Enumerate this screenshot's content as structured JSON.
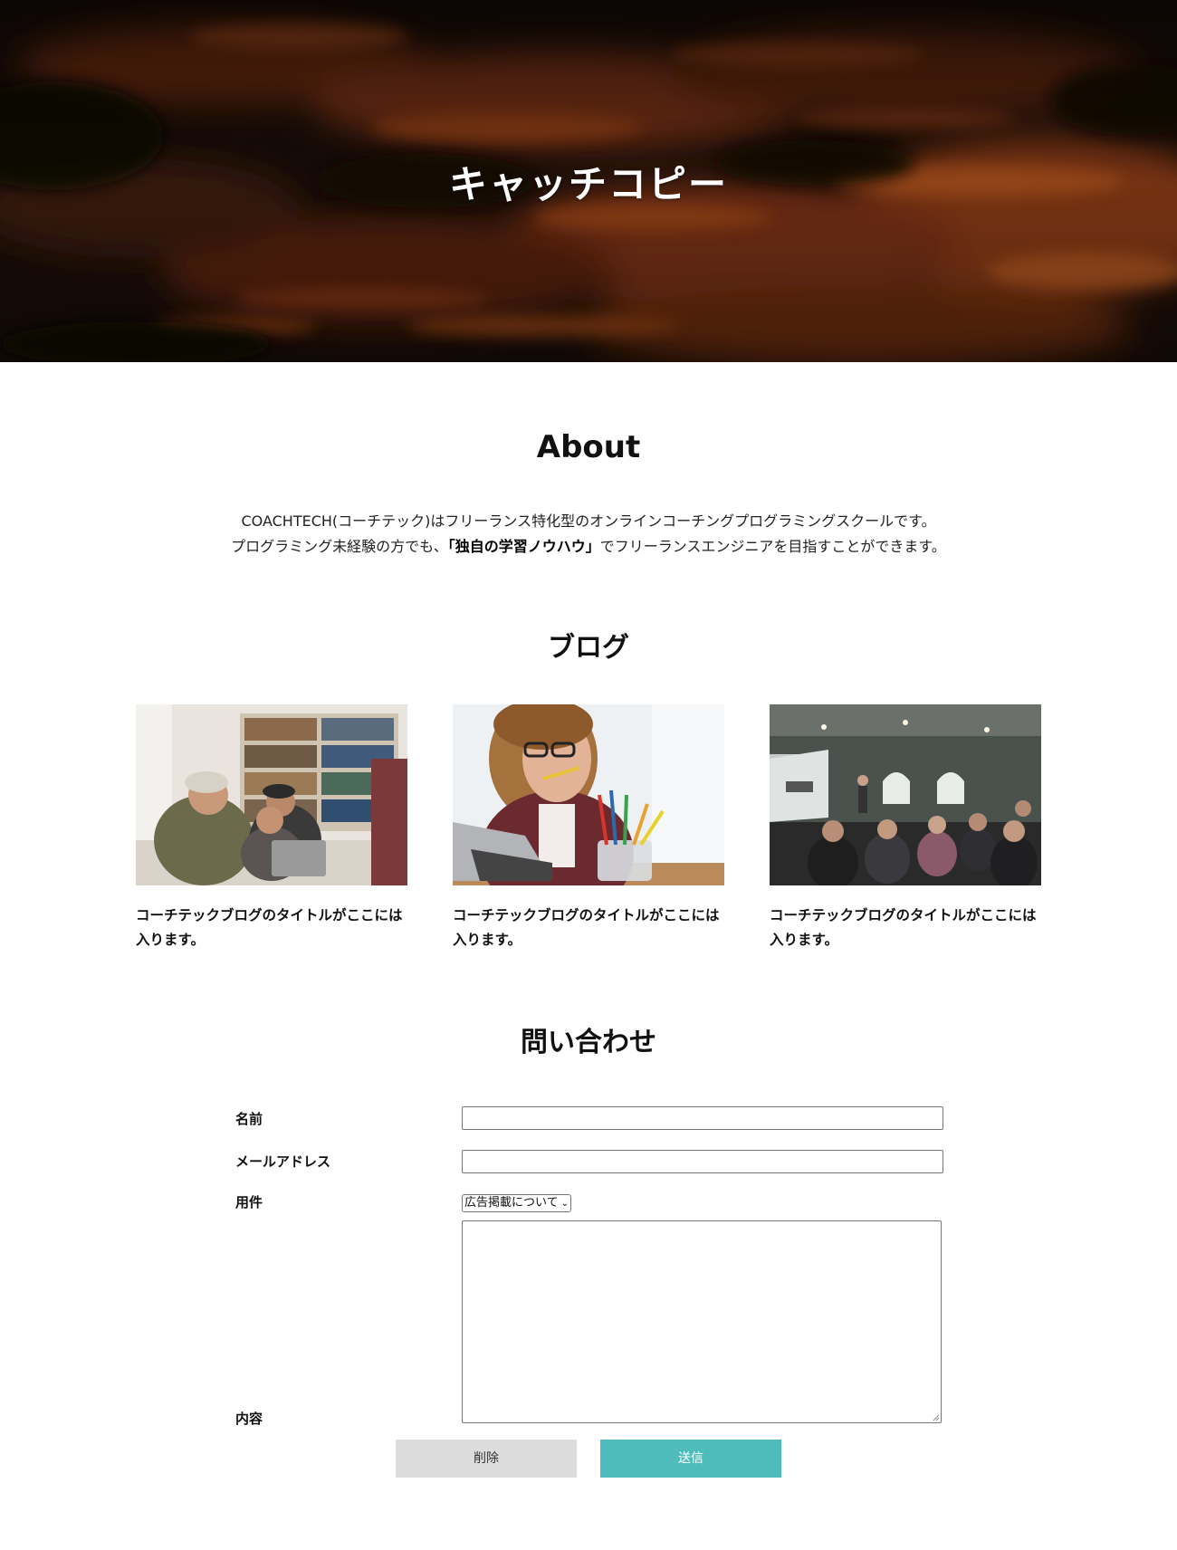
{
  "hero": {
    "catch_copy": "キャッチコピー"
  },
  "about": {
    "title": "About",
    "line1": "COACHTECH(コーチテック)はフリーランス特化型のオンラインコーチングプログラミングスクールです。",
    "line2_prefix": "プログラミング未経験の方でも、",
    "line2_bold": "「独自の学習ノウハウ」",
    "line2_suffix": "でフリーランスエンジニアを目指すことができます。"
  },
  "blog": {
    "title": "ブログ",
    "posts": [
      {
        "title": "コーチテックブログのタイトルがここには入ります。",
        "image": "people-at-laptop-photo"
      },
      {
        "title": "コーチテックブログのタイトルがここには入ります。",
        "image": "woman-with-pencils-photo"
      },
      {
        "title": "コーチテックブログのタイトルがここには入ります。",
        "image": "seminar-room-photo"
      }
    ]
  },
  "contact": {
    "title": "問い合わせ",
    "name_label": "名前",
    "name_value": "",
    "email_label": "メールアドレス",
    "email_value": "",
    "subject_label": "用件",
    "subject_selected": "広告掲載について",
    "message_label": "内容",
    "message_value": "",
    "delete_label": "削除",
    "send_label": "送信"
  },
  "colors": {
    "send_button": "#4fbcbc",
    "delete_button": "#dcdcdc"
  }
}
